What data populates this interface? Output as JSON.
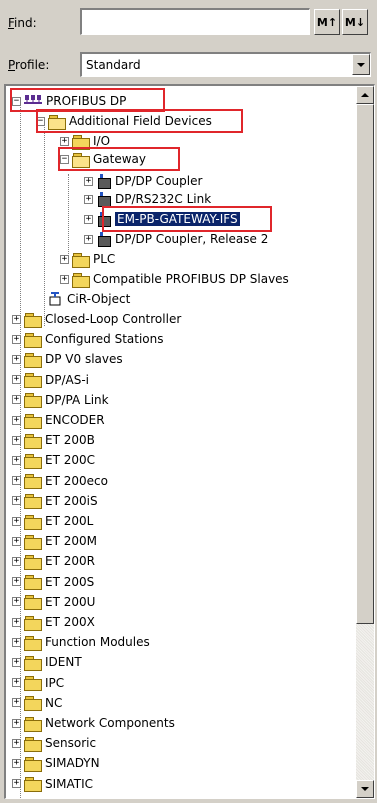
{
  "find": {
    "label_prefix": "",
    "label_u": "F",
    "label_rest": "ind:",
    "value": "",
    "prev_icon": "find-up-icon",
    "next_icon": "find-down-icon"
  },
  "profile": {
    "label_u": "P",
    "label_rest": "rofile:",
    "selected": "Standard"
  },
  "tree": {
    "root": "PROFIBUS DP",
    "additional": "Additional Field Devices",
    "io": "I/O",
    "gateway": "Gateway",
    "gw_items": [
      "DP/DP Coupler",
      "DP/RS232C Link",
      "EM-PB-GATEWAY-IFS",
      "DP/DP Coupler, Release 2"
    ],
    "plc": "PLC",
    "compatible": "Compatible PROFIBUS DP Slaves",
    "cir": "CiR-Object",
    "folders": [
      "Closed-Loop Controller",
      "Configured Stations",
      "DP V0 slaves",
      "DP/AS-i",
      "DP/PA Link",
      "ENCODER",
      "ET 200B",
      "ET 200C",
      "ET 200eco",
      "ET 200iS",
      "ET 200L",
      "ET 200M",
      "ET 200R",
      "ET 200S",
      "ET 200U",
      "ET 200X",
      "Function Modules",
      "IDENT",
      "IPC",
      "NC",
      "Network Components",
      "Sensoric",
      "SIMADYN",
      "SIMATIC"
    ]
  },
  "colors": {
    "highlight": "#e0262b",
    "selection": "#0a246a"
  }
}
